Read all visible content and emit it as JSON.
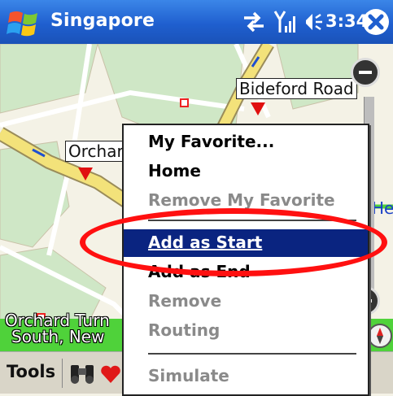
{
  "titlebar": {
    "title": "Singapore",
    "time": "3:34",
    "icons": [
      "windows-start-icon",
      "connectivity-icon",
      "signal-icon",
      "speaker-icon",
      "close-icon"
    ]
  },
  "map": {
    "labels": {
      "bideford": "Bideford Road",
      "orchard": "Orchard",
      "partial_right": "He"
    },
    "status_line1": "Orchard Turn",
    "status_line2": "South, New",
    "colors": {
      "road": "#f3e27a",
      "park": "#cfe7c6",
      "land": "#f4f2e6",
      "status": "#4fd23a"
    }
  },
  "context_menu": {
    "items": [
      {
        "label": "My Favorite...",
        "enabled": true
      },
      {
        "label": "Home",
        "enabled": true
      },
      {
        "label": "Remove My Favorite",
        "enabled": false
      },
      {
        "label": "Add as Start",
        "enabled": true,
        "selected": true
      },
      {
        "label": "Add as End",
        "enabled": true
      },
      {
        "label": "Remove",
        "enabled": false
      },
      {
        "label": "Routing",
        "enabled": false
      },
      {
        "label": "Simulate",
        "enabled": false
      }
    ],
    "selected_color": "#0a2480",
    "highlight_color": "#ff1010"
  },
  "toolbar": {
    "tools_label": "Tools",
    "icons": [
      "binoculars-icon",
      "favorites-heart-icon"
    ]
  }
}
